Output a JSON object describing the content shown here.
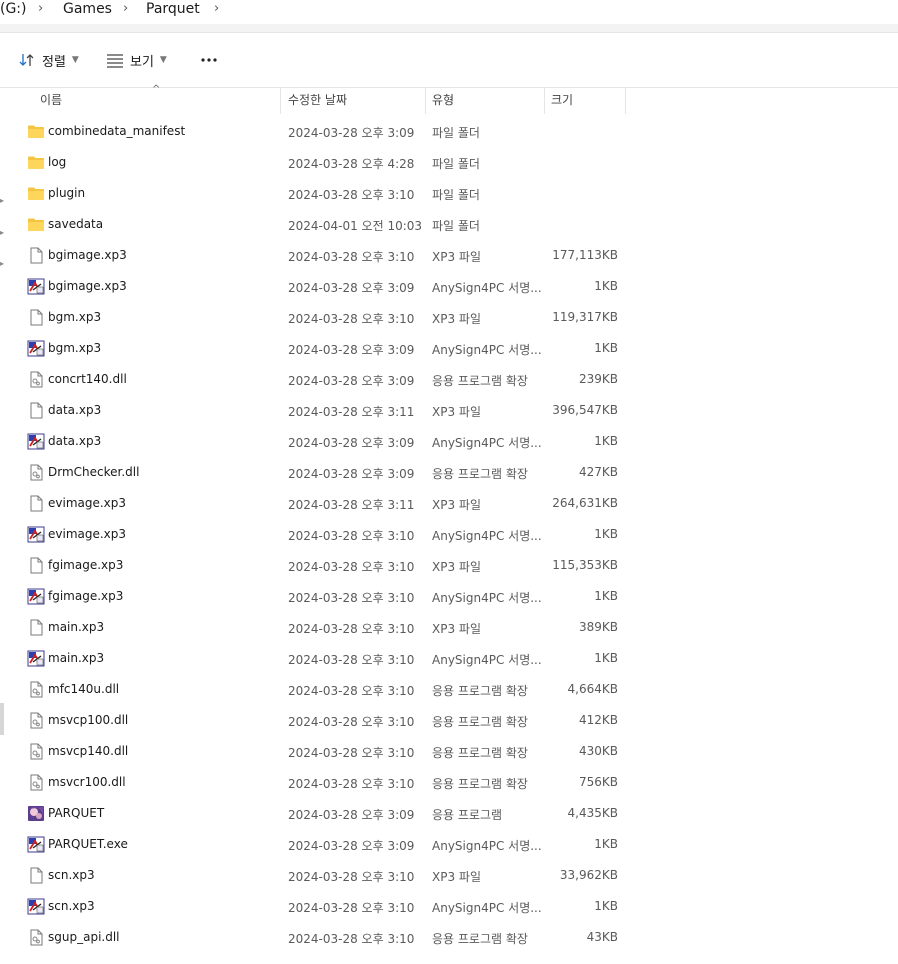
{
  "breadcrumb": {
    "drive": "(G:)",
    "folders": [
      "Games",
      "Parquet"
    ]
  },
  "toolbar": {
    "sort_label": "정렬",
    "view_label": "보기",
    "more_label": "···"
  },
  "columns": {
    "name": "이름",
    "date": "수정한 날짜",
    "type": "유형",
    "size": "크기"
  },
  "files": [
    {
      "name": "combinedata_manifest",
      "date": "2024-03-28 오후 3:09",
      "type": "파일 폴더",
      "size": "",
      "icon": "folder-icon"
    },
    {
      "name": "log",
      "date": "2024-03-28 오후 4:28",
      "type": "파일 폴더",
      "size": "",
      "icon": "folder-icon"
    },
    {
      "name": "plugin",
      "date": "2024-03-28 오후 3:10",
      "type": "파일 폴더",
      "size": "",
      "icon": "folder-icon"
    },
    {
      "name": "savedata",
      "date": "2024-04-01 오전 10:03",
      "type": "파일 폴더",
      "size": "",
      "icon": "folder-icon"
    },
    {
      "name": "bgimage.xp3",
      "date": "2024-03-28 오후 3:10",
      "type": "XP3 파일",
      "size": "177,113KB",
      "icon": "file-icon"
    },
    {
      "name": "bgimage.xp3",
      "date": "2024-03-28 오후 3:09",
      "type": "AnySign4PC 서명...",
      "size": "1KB",
      "icon": "signature-file-icon"
    },
    {
      "name": "bgm.xp3",
      "date": "2024-03-28 오후 3:10",
      "type": "XP3 파일",
      "size": "119,317KB",
      "icon": "file-icon"
    },
    {
      "name": "bgm.xp3",
      "date": "2024-03-28 오후 3:09",
      "type": "AnySign4PC 서명...",
      "size": "1KB",
      "icon": "signature-file-icon"
    },
    {
      "name": "concrt140.dll",
      "date": "2024-03-28 오후 3:09",
      "type": "응용 프로그램 확장",
      "size": "239KB",
      "icon": "dll-file-icon"
    },
    {
      "name": "data.xp3",
      "date": "2024-03-28 오후 3:11",
      "type": "XP3 파일",
      "size": "396,547KB",
      "icon": "file-icon"
    },
    {
      "name": "data.xp3",
      "date": "2024-03-28 오후 3:09",
      "type": "AnySign4PC 서명...",
      "size": "1KB",
      "icon": "signature-file-icon"
    },
    {
      "name": "DrmChecker.dll",
      "date": "2024-03-28 오후 3:09",
      "type": "응용 프로그램 확장",
      "size": "427KB",
      "icon": "dll-file-icon"
    },
    {
      "name": "evimage.xp3",
      "date": "2024-03-28 오후 3:11",
      "type": "XP3 파일",
      "size": "264,631KB",
      "icon": "file-icon"
    },
    {
      "name": "evimage.xp3",
      "date": "2024-03-28 오후 3:10",
      "type": "AnySign4PC 서명...",
      "size": "1KB",
      "icon": "signature-file-icon"
    },
    {
      "name": "fgimage.xp3",
      "date": "2024-03-28 오후 3:10",
      "type": "XP3 파일",
      "size": "115,353KB",
      "icon": "file-icon"
    },
    {
      "name": "fgimage.xp3",
      "date": "2024-03-28 오후 3:10",
      "type": "AnySign4PC 서명...",
      "size": "1KB",
      "icon": "signature-file-icon"
    },
    {
      "name": "main.xp3",
      "date": "2024-03-28 오후 3:10",
      "type": "XP3 파일",
      "size": "389KB",
      "icon": "file-icon"
    },
    {
      "name": "main.xp3",
      "date": "2024-03-28 오후 3:10",
      "type": "AnySign4PC 서명...",
      "size": "1KB",
      "icon": "signature-file-icon"
    },
    {
      "name": "mfc140u.dll",
      "date": "2024-03-28 오후 3:10",
      "type": "응용 프로그램 확장",
      "size": "4,664KB",
      "icon": "dll-file-icon"
    },
    {
      "name": "msvcp100.dll",
      "date": "2024-03-28 오후 3:10",
      "type": "응용 프로그램 확장",
      "size": "412KB",
      "icon": "dll-file-icon"
    },
    {
      "name": "msvcp140.dll",
      "date": "2024-03-28 오후 3:10",
      "type": "응용 프로그램 확장",
      "size": "430KB",
      "icon": "dll-file-icon"
    },
    {
      "name": "msvcr100.dll",
      "date": "2024-03-28 오후 3:10",
      "type": "응용 프로그램 확장",
      "size": "756KB",
      "icon": "dll-file-icon"
    },
    {
      "name": "PARQUET",
      "date": "2024-03-28 오후 3:09",
      "type": "응용 프로그램",
      "size": "4,435KB",
      "icon": "app-icon"
    },
    {
      "name": "PARQUET.exe",
      "date": "2024-03-28 오후 3:09",
      "type": "AnySign4PC 서명...",
      "size": "1KB",
      "icon": "signature-file-icon"
    },
    {
      "name": "scn.xp3",
      "date": "2024-03-28 오후 3:10",
      "type": "XP3 파일",
      "size": "33,962KB",
      "icon": "file-icon"
    },
    {
      "name": "scn.xp3",
      "date": "2024-03-28 오후 3:10",
      "type": "AnySign4PC 서명...",
      "size": "1KB",
      "icon": "signature-file-icon"
    },
    {
      "name": "sgup_api.dll",
      "date": "2024-03-28 오후 3:10",
      "type": "응용 프로그램 확장",
      "size": "43KB",
      "icon": "dll-file-icon"
    }
  ]
}
